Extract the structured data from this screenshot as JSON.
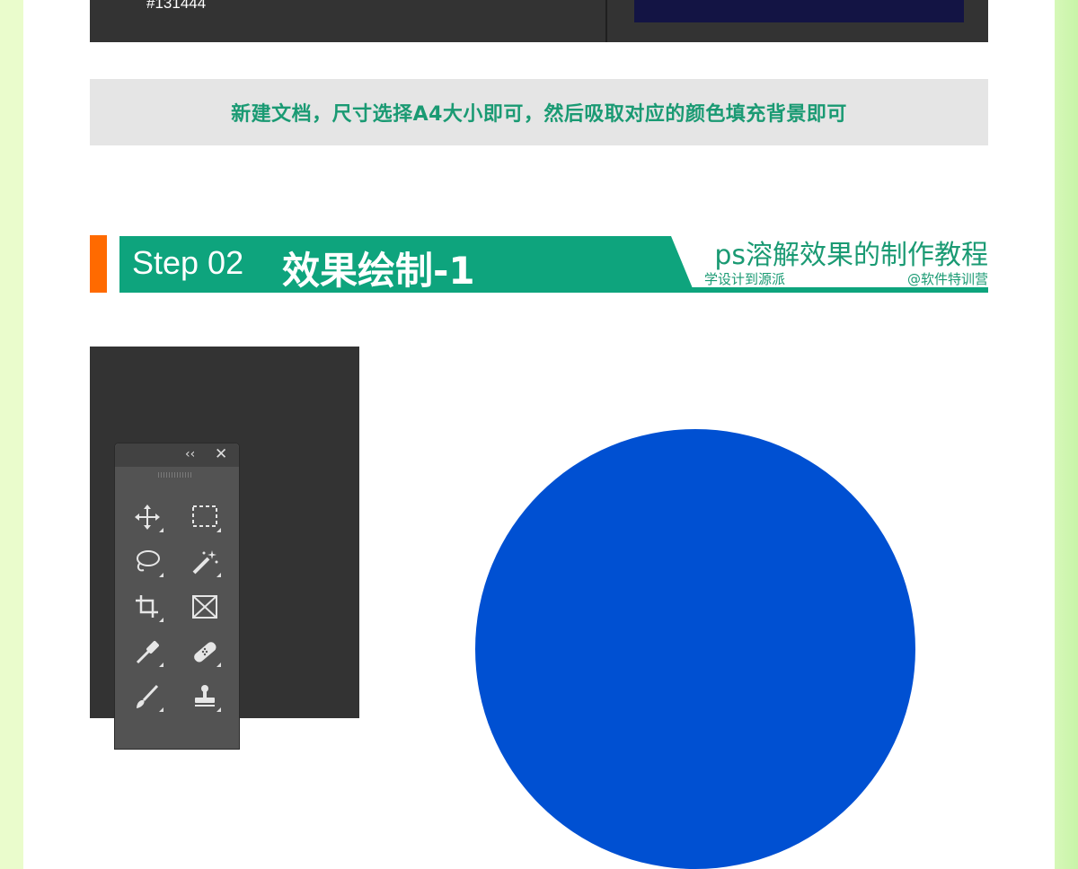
{
  "previous_step": {
    "hex_label": "#131444",
    "swatch_color": "#131444"
  },
  "instruction": {
    "text": "新建文档，尺寸选择A4大小即可，然后吸取对应的颜色填充背景即可"
  },
  "step_header": {
    "step_label": "Step 02",
    "step_title": "效果绘制-1",
    "course_title": "ps溶解效果的制作教程",
    "tagline": "学设计到源派",
    "credit": "@软件特训营",
    "accent_color": "#ff6a00",
    "bar_color": "#0ea47d"
  },
  "photoshop": {
    "toolbar": {
      "collapse_label": "‹‹",
      "close_label": "✕",
      "tools": [
        {
          "name": "move-tool",
          "icon": "move-icon"
        },
        {
          "name": "rectangular-marquee-tool",
          "icon": "marquee-icon"
        },
        {
          "name": "lasso-tool",
          "icon": "lasso-icon"
        },
        {
          "name": "magic-wand-tool",
          "icon": "magic-wand-icon"
        },
        {
          "name": "crop-tool",
          "icon": "crop-icon"
        },
        {
          "name": "frame-tool",
          "icon": "frame-icon"
        },
        {
          "name": "eyedropper-tool",
          "icon": "eyedropper-icon"
        },
        {
          "name": "healing-brush-tool",
          "icon": "bandage-icon"
        },
        {
          "name": "brush-tool",
          "icon": "brush-icon"
        },
        {
          "name": "clone-stamp-tool",
          "icon": "stamp-icon"
        }
      ]
    },
    "canvas": {
      "circle_color": "#0050d2"
    }
  }
}
